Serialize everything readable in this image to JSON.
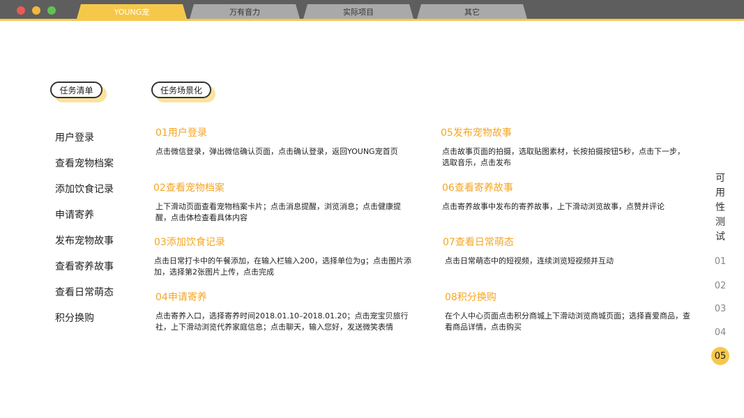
{
  "window": {
    "tabs": [
      {
        "label": "YOUNG宠"
      },
      {
        "label": "万有音力"
      },
      {
        "label": "实际项目"
      },
      {
        "label": "其它"
      }
    ]
  },
  "headers": {
    "task_list": "任务清单",
    "scenario": "任务场景化"
  },
  "task_list": [
    "用户登录",
    "查看宠物档案",
    "添加饮食记录",
    "申请寄养",
    "发布宠物故事",
    "查看寄养故事",
    "查看日常萌态",
    "积分换购"
  ],
  "scenarios": [
    {
      "title": "01用户登录",
      "desc": "点击微信登录，弹出微信确认页面，点击确认登录，返回YOUNG宠首页"
    },
    {
      "title": "02查看宠物档案",
      "desc": "上下滑动页面查看宠物档案卡片；点击消息提醒，浏览消息；点击健康提醒，点击体检查看具体内容"
    },
    {
      "title": "03添加饮食记录",
      "desc": "点击日常打卡中的午餐添加，在输入栏输入200，选择单位为g；点击图片添加，选择第2张图片上传，点击完成"
    },
    {
      "title": "04申请寄养",
      "desc": "点击寄养入口，选择寄养时间2018.01.10–2018.01.20；点击宠宝贝旅行社，上下滑动浏览代养家庭信息；点击聊天，输入您好，发送微笑表情"
    },
    {
      "title": "05发布宠物故事",
      "desc": "点击故事页面的拍摄，选取贴图素材，长按拍摄按钮5秒，点击下一步，选取音乐，点击发布"
    },
    {
      "title": "06查看寄养故事",
      "desc": "点击寄养故事中发布的寄养故事，上下滑动浏览故事，点赞并评论"
    },
    {
      "title": "07查看日常萌态",
      "desc": "点击日常萌态中的短视频，连续浏览短视频并互动"
    },
    {
      "title": "08积分换购",
      "desc": "在个人中心页面点击积分商城上下滑动浏览商城页面；选择喜爱商品，查看商品详情，点击购买"
    }
  ],
  "side_nav": {
    "title_chars": [
      "可",
      "用",
      "性",
      "测",
      "试"
    ],
    "pages": [
      "01",
      "02",
      "03",
      "04",
      "05"
    ],
    "active_page": "05"
  },
  "colors": {
    "accent": "#f6c84a",
    "title_orange": "#f5a623",
    "titlebar": "#5e5e5e"
  }
}
